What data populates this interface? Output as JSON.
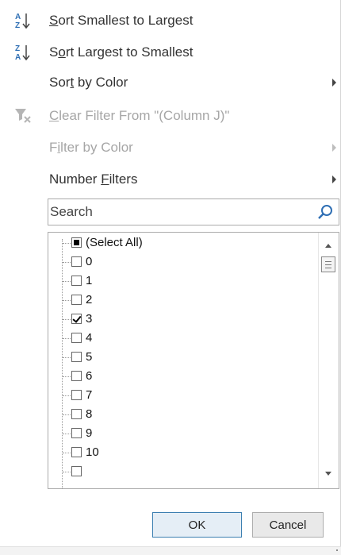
{
  "menu": {
    "sort_asc": {
      "pre": "",
      "accel": "S",
      "post": "ort Smallest to Largest"
    },
    "sort_desc": {
      "pre": "S",
      "accel": "o",
      "post": "rt Largest to Smallest"
    },
    "sort_by_color": {
      "pre": "Sor",
      "accel": "t",
      "post": " by Color"
    },
    "clear_filter": {
      "pre": "",
      "accel": "C",
      "post": "lear Filter From \"(Column J)\""
    },
    "filter_by_color": {
      "pre": "F",
      "accel": "i",
      "post": "lter by Color"
    },
    "number_filters": {
      "pre": "Number ",
      "accel": "F",
      "post": "ilters"
    }
  },
  "search": {
    "placeholder": "Search",
    "value": ""
  },
  "list": {
    "items": [
      {
        "label": "(Select All)",
        "state": "indeterminate"
      },
      {
        "label": "0",
        "state": "unchecked"
      },
      {
        "label": "1",
        "state": "unchecked"
      },
      {
        "label": "2",
        "state": "unchecked"
      },
      {
        "label": "3",
        "state": "checked"
      },
      {
        "label": "4",
        "state": "unchecked"
      },
      {
        "label": "5",
        "state": "unchecked"
      },
      {
        "label": "6",
        "state": "unchecked"
      },
      {
        "label": "7",
        "state": "unchecked"
      },
      {
        "label": "8",
        "state": "unchecked"
      },
      {
        "label": "9",
        "state": "unchecked"
      },
      {
        "label": "10",
        "state": "unchecked"
      },
      {
        "label": "",
        "state": "unchecked"
      }
    ]
  },
  "buttons": {
    "ok": "OK",
    "cancel": "Cancel"
  },
  "colors": {
    "accent_blue": "#3c7fb1",
    "icon_blue": "#2f6fb4",
    "disabled_text": "#a6a6a6"
  },
  "icons": {
    "sort_asc": "sort-ascending-icon",
    "sort_desc": "sort-descending-icon",
    "clear_filter": "clear-filter-icon",
    "search": "search-icon"
  }
}
